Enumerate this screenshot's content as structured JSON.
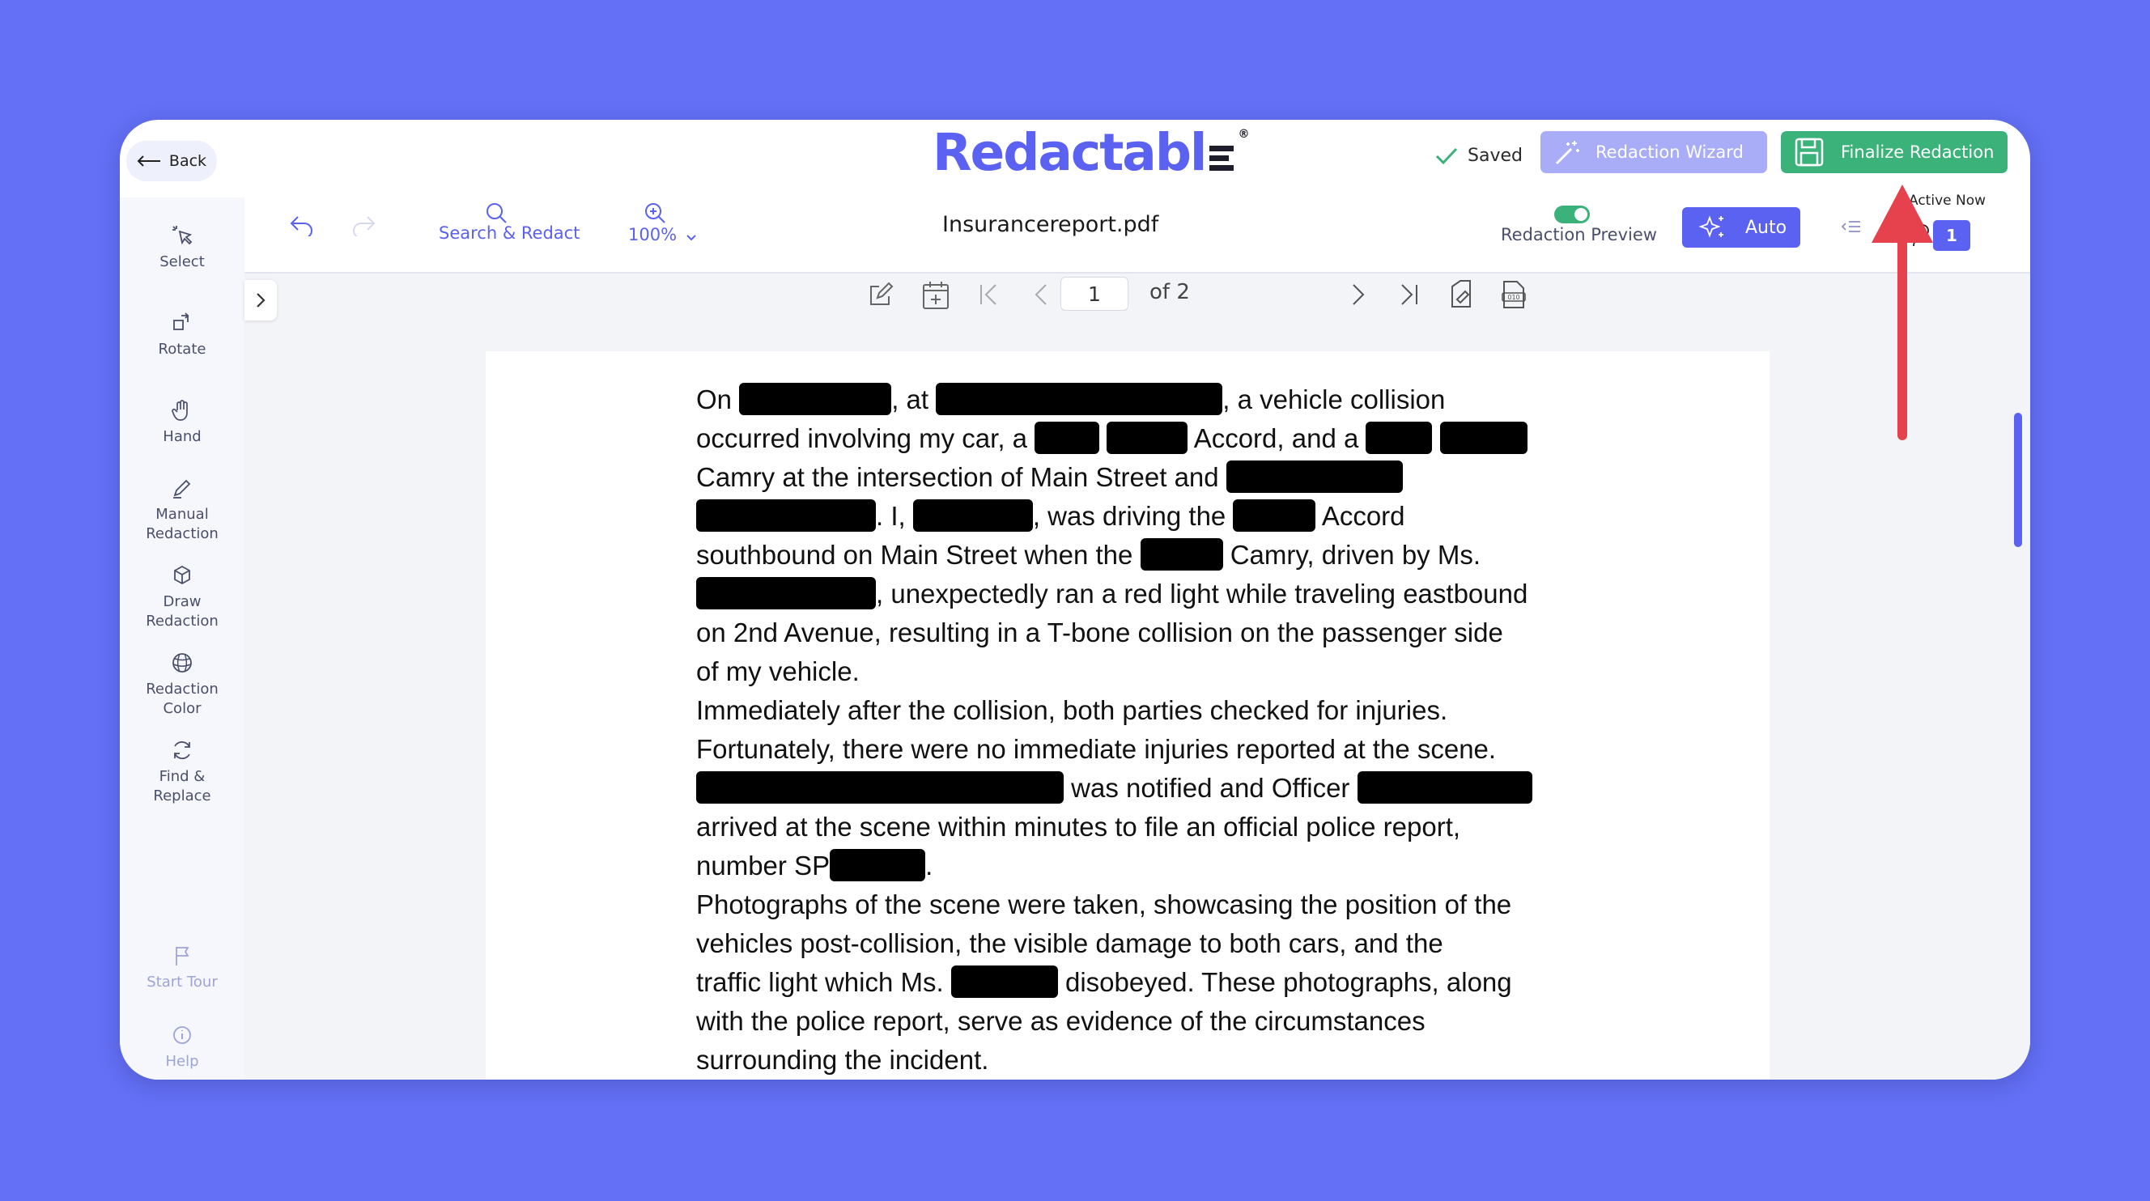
{
  "header": {
    "back_label": "Back",
    "logo_text": "Redactabl",
    "logo_reg": "®",
    "saved_label": "Saved",
    "wizard_label": "Redaction Wizard",
    "finalize_label": "Finalize Redaction"
  },
  "toolbar": {
    "search_label": "Search & Redact",
    "zoom_label": "100%",
    "filename": "Insurancereport.pdf",
    "preview_label": "Redaction Preview",
    "auto_label": "Auto",
    "active_now_label": "Active Now",
    "active_count": "1"
  },
  "sidebar": {
    "items": [
      {
        "label": "Select"
      },
      {
        "label": "Rotate"
      },
      {
        "label": "Hand"
      },
      {
        "label": "Manual\nRedaction"
      },
      {
        "label": "Draw\nRedaction"
      },
      {
        "label": "Redaction\nColor"
      },
      {
        "label": "Find &\nReplace"
      },
      {
        "label": "Start Tour"
      },
      {
        "label": "Help"
      }
    ]
  },
  "pager": {
    "current_page": "1",
    "of_label": "of 2"
  },
  "document": {
    "p1_a": "On ",
    "p1_b": ", at ",
    "p1_c": ", a vehicle collision",
    "p2_a": "occurred involving my car, a ",
    "p2_b": " Accord, and a ",
    "p3_a": "Camry at the intersection of Main Street and ",
    "p4_a": ". I, ",
    "p4_b": ", was driving the ",
    "p4_c": " Accord",
    "p5_a": "southbound on Main Street when the ",
    "p5_b": " Camry, driven by Ms.",
    "p6_a": ", unexpectedly ran a red light while traveling eastbound",
    "p7": "on 2nd Avenue, resulting in a T-bone collision on the passenger side",
    "p8": "of my vehicle.",
    "p9": "Immediately after the collision, both parties checked for injuries.",
    "p10": "Fortunately, there were no immediate injuries reported at the scene.",
    "p11_a": " was notified and Officer ",
    "p12": "arrived at the scene within minutes to file an official police report,",
    "p13_a": "number SP",
    "p13_b": ".",
    "p14": "Photographs of the scene were taken, showcasing the position of the",
    "p15": "vehicles post-collision, the visible damage to both cars, and the",
    "p16_a": "traffic light which Ms. ",
    "p16_b": " disobeyed. These photographs, along",
    "p17": "with the police report, serve as evidence of the circumstances",
    "p18": "surrounding the incident."
  },
  "colors": {
    "background": "#6470f6",
    "brand": "#5b61f0",
    "finalize": "#3ab27a",
    "wizard": "#a9acf6",
    "annotation_arrow": "#e5424d"
  }
}
